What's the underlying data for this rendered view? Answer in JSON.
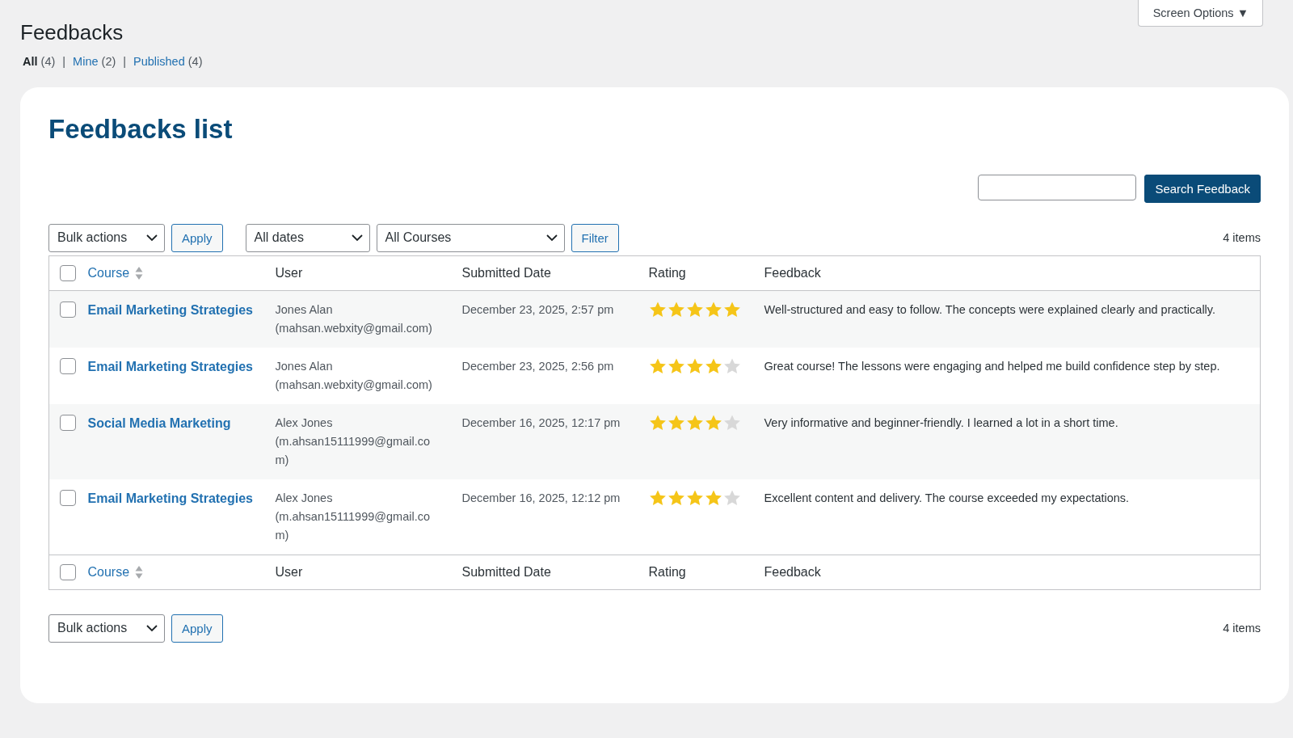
{
  "page": {
    "title": "Feedbacks",
    "screen_options": "Screen Options ▼",
    "views": [
      {
        "label": "All",
        "count": "(4)",
        "selected": true
      },
      {
        "separator": "|",
        "label": "Mine",
        "count": "(2)",
        "selected": false
      },
      {
        "separator": "|",
        "label": "Published",
        "count": "(4)",
        "selected": false
      }
    ]
  },
  "card": {
    "title": "Feedbacks list",
    "search_button": "Search Feedback",
    "top_nav": {
      "bulk_actions": "Bulk actions",
      "apply": "Apply",
      "date_filter": "All dates",
      "course_filter": "All Courses",
      "filter": "Filter",
      "count": "4 items"
    },
    "columns": [
      {
        "label": "Course",
        "sortable": true
      },
      {
        "label": "User",
        "sortable": false
      },
      {
        "label": "Submitted Date",
        "sortable": false
      },
      {
        "label": "Rating",
        "sortable": false
      },
      {
        "label": "Feedback",
        "sortable": false
      }
    ],
    "rows": [
      {
        "checked": false,
        "course": "Email Marketing Strategies",
        "user": "Jones Alan (mahsan.webxity@gmail.com)",
        "date": "December 23, 2025, 2:57 pm",
        "stars": 5,
        "feedback": "Well-structured and easy to follow. The concepts were explained clearly and practically."
      },
      {
        "checked": false,
        "course": "Email Marketing Strategies",
        "user": "Jones Alan (mahsan.webxity@gmail.com)",
        "date": "December 23, 2025, 2:56 pm",
        "stars": 4,
        "feedback": "Great course! The lessons were engaging and helped me build confidence step by step."
      },
      {
        "checked": false,
        "course": "Social Media Marketing",
        "user": "Alex Jones (m.ahsan15111999@gmail.com)",
        "date": "December 16, 2025, 12:17 pm",
        "stars": 4,
        "feedback": "Very informative and beginner-friendly. I learned a lot in a short time."
      },
      {
        "checked": false,
        "course": "Email Marketing Strategies",
        "user": "Alex Jones (m.ahsan15111999@gmail.com)",
        "date": "December 16, 2025, 12:12 pm",
        "stars": 4,
        "feedback": "Excellent content and delivery. The course exceeded my expectations."
      }
    ],
    "header_checked": false,
    "footer_checked": false,
    "footer_columns": [
      {
        "label": "Course",
        "sortable": true
      },
      {
        "label": "User",
        "sortable": false
      },
      {
        "label": "Submitted Date",
        "sortable": false
      },
      {
        "label": "Rating",
        "sortable": false
      },
      {
        "label": "Feedback",
        "sortable": false
      }
    ],
    "bottom_nav": {
      "bulk_actions": "Bulk actions",
      "apply": "Apply",
      "count": "4 items"
    }
  }
}
